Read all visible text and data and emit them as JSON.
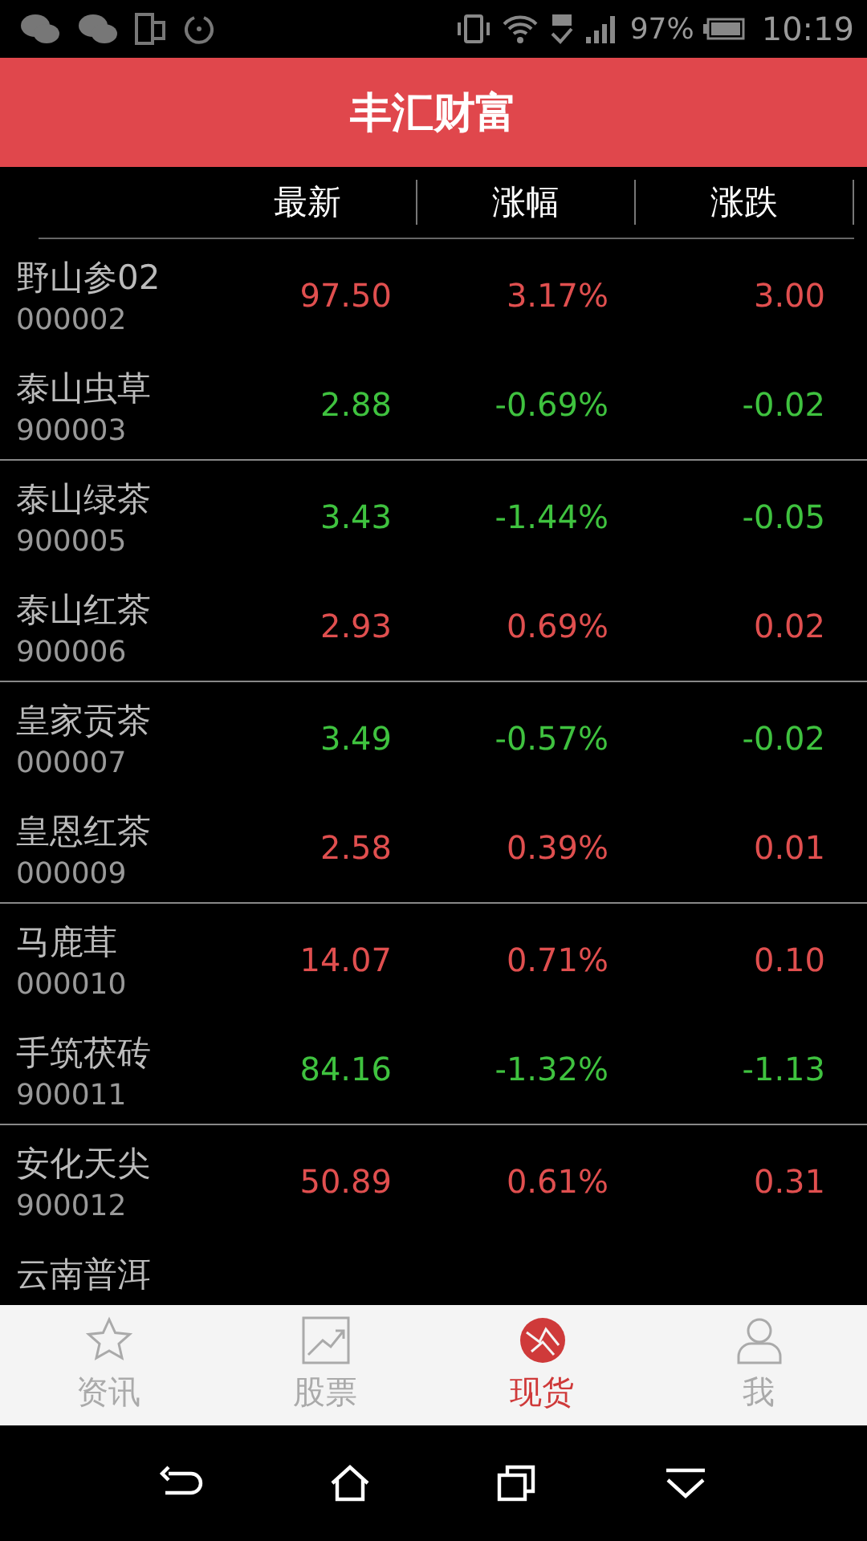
{
  "status_bar": {
    "battery": "97%",
    "time": "10:19"
  },
  "header": {
    "title": "丰汇财富"
  },
  "columns": [
    "最新",
    "涨幅",
    "涨跌"
  ],
  "rows": [
    {
      "name": "野山参02",
      "code": "000002",
      "price": "97.50",
      "change_pct": "3.17%",
      "change": "3.00",
      "kind": "up"
    },
    {
      "name": "泰山虫草",
      "code": "900003",
      "price": "2.88",
      "change_pct": "-0.69%",
      "change": "-0.02",
      "kind": "down"
    },
    {
      "name": "泰山绿茶",
      "code": "900005",
      "price": "3.43",
      "change_pct": "-1.44%",
      "change": "-0.05",
      "kind": "down"
    },
    {
      "name": "泰山红茶",
      "code": "900006",
      "price": "2.93",
      "change_pct": "0.69%",
      "change": "0.02",
      "kind": "up"
    },
    {
      "name": "皇家贡茶",
      "code": "000007",
      "price": "3.49",
      "change_pct": "-0.57%",
      "change": "-0.02",
      "kind": "down"
    },
    {
      "name": "皇恩红茶",
      "code": "000009",
      "price": "2.58",
      "change_pct": "0.39%",
      "change": "0.01",
      "kind": "up"
    },
    {
      "name": "马鹿茸",
      "code": "000010",
      "price": "14.07",
      "change_pct": "0.71%",
      "change": "0.10",
      "kind": "up"
    },
    {
      "name": "手筑茯砖",
      "code": "900011",
      "price": "84.16",
      "change_pct": "-1.32%",
      "change": "-1.13",
      "kind": "down"
    },
    {
      "name": "安化天尖",
      "code": "900012",
      "price": "50.89",
      "change_pct": "0.61%",
      "change": "0.31",
      "kind": "up"
    },
    {
      "name": "云南普洱"
    }
  ],
  "tabs": [
    {
      "label": "资讯",
      "selected": false
    },
    {
      "label": "股票",
      "selected": false
    },
    {
      "label": "现货",
      "selected": true
    },
    {
      "label": "我",
      "selected": false
    }
  ]
}
